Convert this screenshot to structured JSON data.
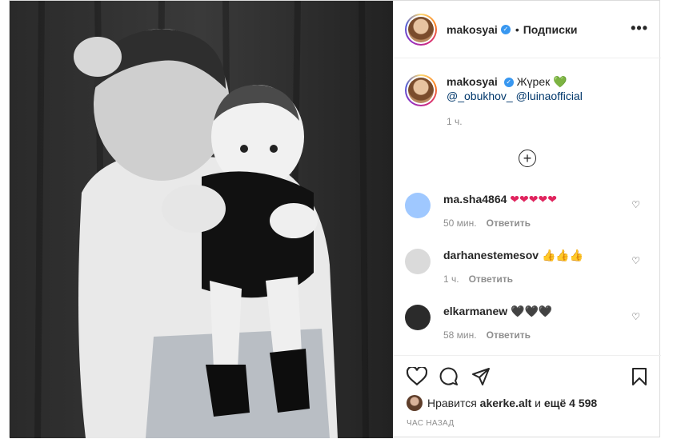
{
  "post": {
    "username": "makosyai",
    "follow_dot": "•",
    "follow_label": "Подписки",
    "more_label": "•••"
  },
  "caption": {
    "username": "makosyai",
    "text": "Жүрек",
    "heart": "💚",
    "mention1": "@_obukhov_",
    "mention2": "@luinaofficial",
    "time": "1 ч.",
    "add_icon": "+"
  },
  "comments": [
    {
      "user": "ma.sha4864",
      "text": "❤❤❤❤❤",
      "time": "50 мин.",
      "reply": "Ответить",
      "avatar_color": "#9fc8ff"
    },
    {
      "user": "darhanestemesov",
      "text": "👍👍👍",
      "time": "1 ч.",
      "reply": "Ответить",
      "avatar_color": "#dadada"
    },
    {
      "user": "elkarmanew",
      "text": "🖤🖤🖤",
      "time": "58 мин.",
      "reply": "Ответить",
      "avatar_color": "#2b2b2b"
    }
  ],
  "likes": {
    "prefix": "Нравится",
    "user": "akerke.alt",
    "middle": "и",
    "rest": "ещё 4 598"
  },
  "ago": "ЧАС НАЗАД",
  "icons": {
    "verified": "✓",
    "heart_outline": "♡"
  }
}
